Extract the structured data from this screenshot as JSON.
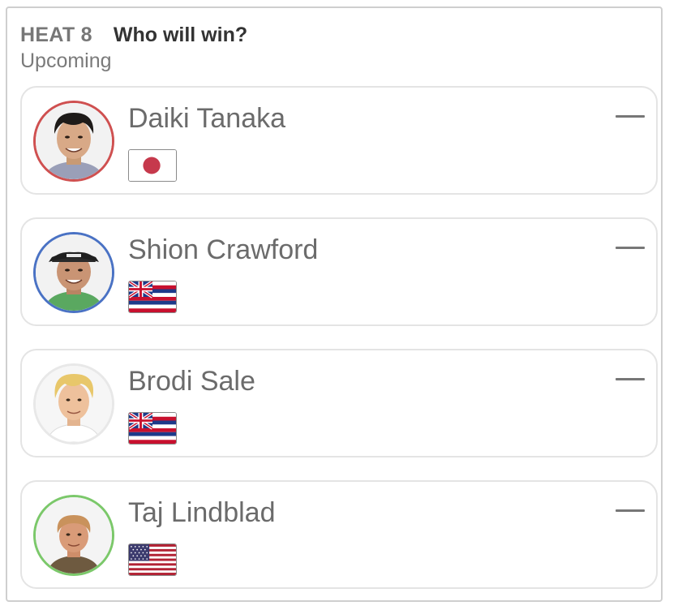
{
  "header": {
    "heat_label": "HEAT 8",
    "question": "Who will win?",
    "status": "Upcoming"
  },
  "surfers": [
    {
      "name": "Daiki Tanaka",
      "flag": "japan-flag",
      "ring_color": "#cf5050",
      "pick": "dash"
    },
    {
      "name": "Shion Crawford",
      "flag": "hawaii-flag",
      "ring_color": "#4a72c4",
      "pick": "dash"
    },
    {
      "name": "Brodi Sale",
      "flag": "hawaii-flag",
      "ring_color": "#e8e8e8",
      "pick": "dash"
    },
    {
      "name": "Taj Lindblad",
      "flag": "usa-flag",
      "ring_color": "#7bc86a",
      "pick": "dash"
    }
  ]
}
